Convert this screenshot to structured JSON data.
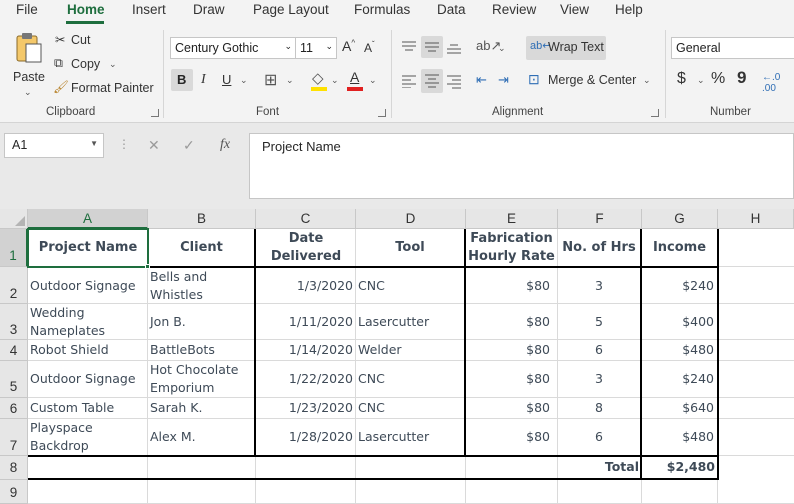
{
  "menu": {
    "tabs": [
      "File",
      "Home",
      "Insert",
      "Draw",
      "Page Layout",
      "Formulas",
      "Data",
      "Review",
      "View",
      "Help"
    ],
    "active": "Home"
  },
  "ribbon": {
    "clipboard": {
      "paste": "Paste",
      "cut": "Cut",
      "copy": "Copy",
      "format_painter": "Format Painter",
      "label": "Clipboard"
    },
    "font": {
      "family": "Century Gothic",
      "size": "11",
      "grow": "A^",
      "shrink": "Aˇ",
      "bold": "B",
      "italic": "I",
      "underline": "U",
      "font_color_letter": "A",
      "label": "Font"
    },
    "alignment": {
      "wrap_text": "Wrap Text",
      "merge_center": "Merge & Center",
      "label": "Alignment"
    },
    "number": {
      "format": "General",
      "currency": "$",
      "percent": "%",
      "comma": "9",
      "label": "Number"
    }
  },
  "formula_bar": {
    "name_box": "A1",
    "content": "Project Name",
    "fx": "fx"
  },
  "sheet": {
    "columns": [
      "A",
      "B",
      "C",
      "D",
      "E",
      "F",
      "G",
      "H"
    ],
    "row_numbers": [
      "1",
      "2",
      "3",
      "4",
      "5",
      "6",
      "7",
      "8",
      "9"
    ],
    "headers": {
      "project": "Project Name",
      "client": "Client",
      "date_l1": "Date",
      "date_l2": "Delivered",
      "tool": "Tool",
      "rate_l1": "Fabrication",
      "rate_l2": "Hourly Rate",
      "hours": "No. of Hrs",
      "income": "Income"
    },
    "rows": [
      {
        "project": [
          "Outdoor Signage"
        ],
        "client": [
          "Bells and",
          "Whistles"
        ],
        "date": "1/3/2020",
        "tool": "CNC",
        "rate": "$80",
        "hours": "3",
        "income": "$240"
      },
      {
        "project": [
          "Wedding",
          "Nameplates"
        ],
        "client": [
          "Jon B."
        ],
        "date": "1/11/2020",
        "tool": "Lasercutter",
        "rate": "$80",
        "hours": "5",
        "income": "$400"
      },
      {
        "project": [
          "Robot Shield"
        ],
        "client": [
          "BattleBots"
        ],
        "date": "1/14/2020",
        "tool": "Welder",
        "rate": "$80",
        "hours": "6",
        "income": "$480"
      },
      {
        "project": [
          "Outdoor Signage"
        ],
        "client": [
          "Hot Chocolate",
          "Emporium"
        ],
        "date": "1/22/2020",
        "tool": "CNC",
        "rate": "$80",
        "hours": "3",
        "income": "$240"
      },
      {
        "project": [
          "Custom Table"
        ],
        "client": [
          "Sarah K."
        ],
        "date": "1/23/2020",
        "tool": "CNC",
        "rate": "$80",
        "hours": "8",
        "income": "$640"
      },
      {
        "project": [
          "Playspace",
          "Backdrop"
        ],
        "client": [
          "Alex M."
        ],
        "date": "1/28/2020",
        "tool": "Lasercutter",
        "rate": "$80",
        "hours": "6",
        "income": "$480"
      }
    ],
    "total_label": "Total",
    "total_value": "$2,480"
  },
  "colors": {
    "accent": "#1e6e3e",
    "cell_text": "#3e4a57",
    "font_color_bar": "#e02020",
    "highlight_bar": "#ffe100"
  }
}
